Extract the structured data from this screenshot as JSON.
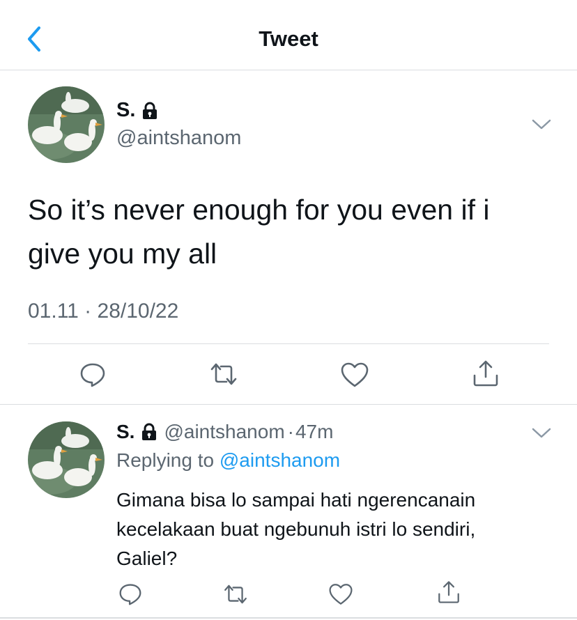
{
  "header": {
    "title": "Tweet"
  },
  "tweet": {
    "author_name": "S.",
    "author_handle": "@aintshanom",
    "text_line1": "So it’s never enough for you even if i",
    "text_line2": "give you my all",
    "timestamp": "01.11 · 28/10/22"
  },
  "reply": {
    "author_name": "S.",
    "author_handle": "@aintshanom",
    "separator": "·",
    "age": "47m",
    "replying_prefix": "Replying to",
    "replying_handle": "@aintshanom",
    "text_line1": "Gimana bisa lo sampai hati ngerencanain",
    "text_line2": "kecelakaan buat ngebunuh istri lo sendiri,",
    "text_line3": "Galiel?"
  },
  "icons": {
    "back": "chevron-left-icon",
    "lock": "lock-icon",
    "more": "chevron-down-icon",
    "reply": "comment-icon",
    "retweet": "retweet-icon",
    "like": "heart-icon",
    "share": "share-icon"
  },
  "colors": {
    "accent": "#1d9bf0",
    "text": "#0f1419",
    "secondary": "#5b6670",
    "divider": "#dadde0"
  }
}
